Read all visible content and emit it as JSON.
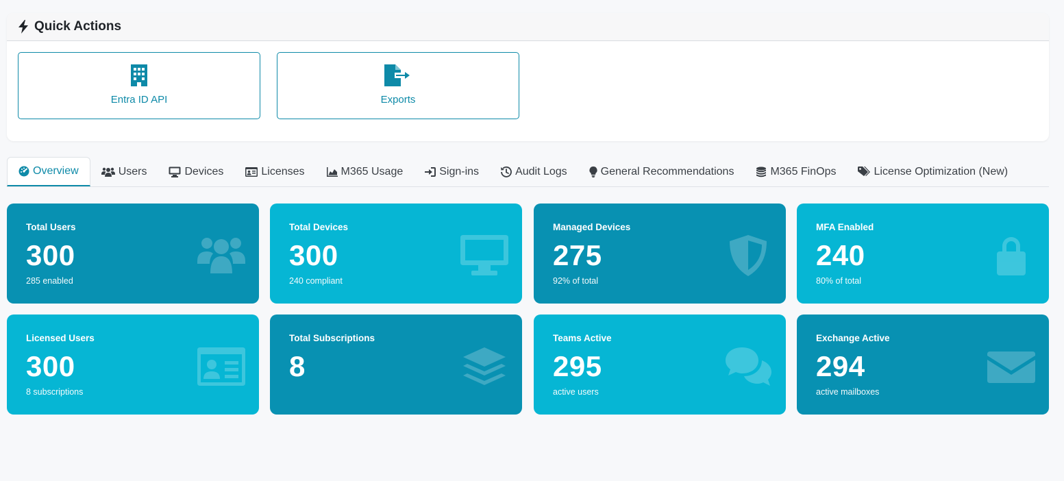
{
  "quick_actions": {
    "title": "Quick Actions",
    "buttons": [
      {
        "label": "Entra ID API",
        "icon": "building-icon"
      },
      {
        "label": "Exports",
        "icon": "file-export-icon"
      }
    ]
  },
  "tabs": [
    {
      "label": "Overview",
      "icon": "gauge-icon",
      "active": true
    },
    {
      "label": "Users",
      "icon": "users-icon"
    },
    {
      "label": "Devices",
      "icon": "desktop-icon"
    },
    {
      "label": "Licenses",
      "icon": "id-card-icon"
    },
    {
      "label": "M365 Usage",
      "icon": "area-chart-icon"
    },
    {
      "label": "Sign-ins",
      "icon": "sign-in-icon"
    },
    {
      "label": "Audit Logs",
      "icon": "history-icon"
    },
    {
      "label": "General Recommendations",
      "icon": "lightbulb-icon"
    },
    {
      "label": "M365 FinOps",
      "icon": "coins-icon"
    },
    {
      "label": "License Optimization (New)",
      "icon": "tags-icon"
    }
  ],
  "stats": [
    {
      "title": "Total Users",
      "value": "300",
      "sub": "285 enabled",
      "icon": "users-icon"
    },
    {
      "title": "Total Devices",
      "value": "300",
      "sub": "240 compliant",
      "icon": "desktop-icon"
    },
    {
      "title": "Managed Devices",
      "value": "275",
      "sub": "92% of total",
      "icon": "shield-icon"
    },
    {
      "title": "MFA Enabled",
      "value": "240",
      "sub": "80% of total",
      "icon": "lock-icon"
    },
    {
      "title": "Licensed Users",
      "value": "300",
      "sub": "8 subscriptions",
      "icon": "id-card-icon"
    },
    {
      "title": "Total Subscriptions",
      "value": "8",
      "sub": "",
      "icon": "layers-icon"
    },
    {
      "title": "Teams Active",
      "value": "295",
      "sub": "active users",
      "icon": "comments-icon"
    },
    {
      "title": "Exchange Active",
      "value": "294",
      "sub": "active mailboxes",
      "icon": "envelope-icon"
    }
  ],
  "colors": {
    "accent": "#0e8aa8",
    "card_dark": "#0891b2",
    "card_light": "#06b6d4"
  }
}
